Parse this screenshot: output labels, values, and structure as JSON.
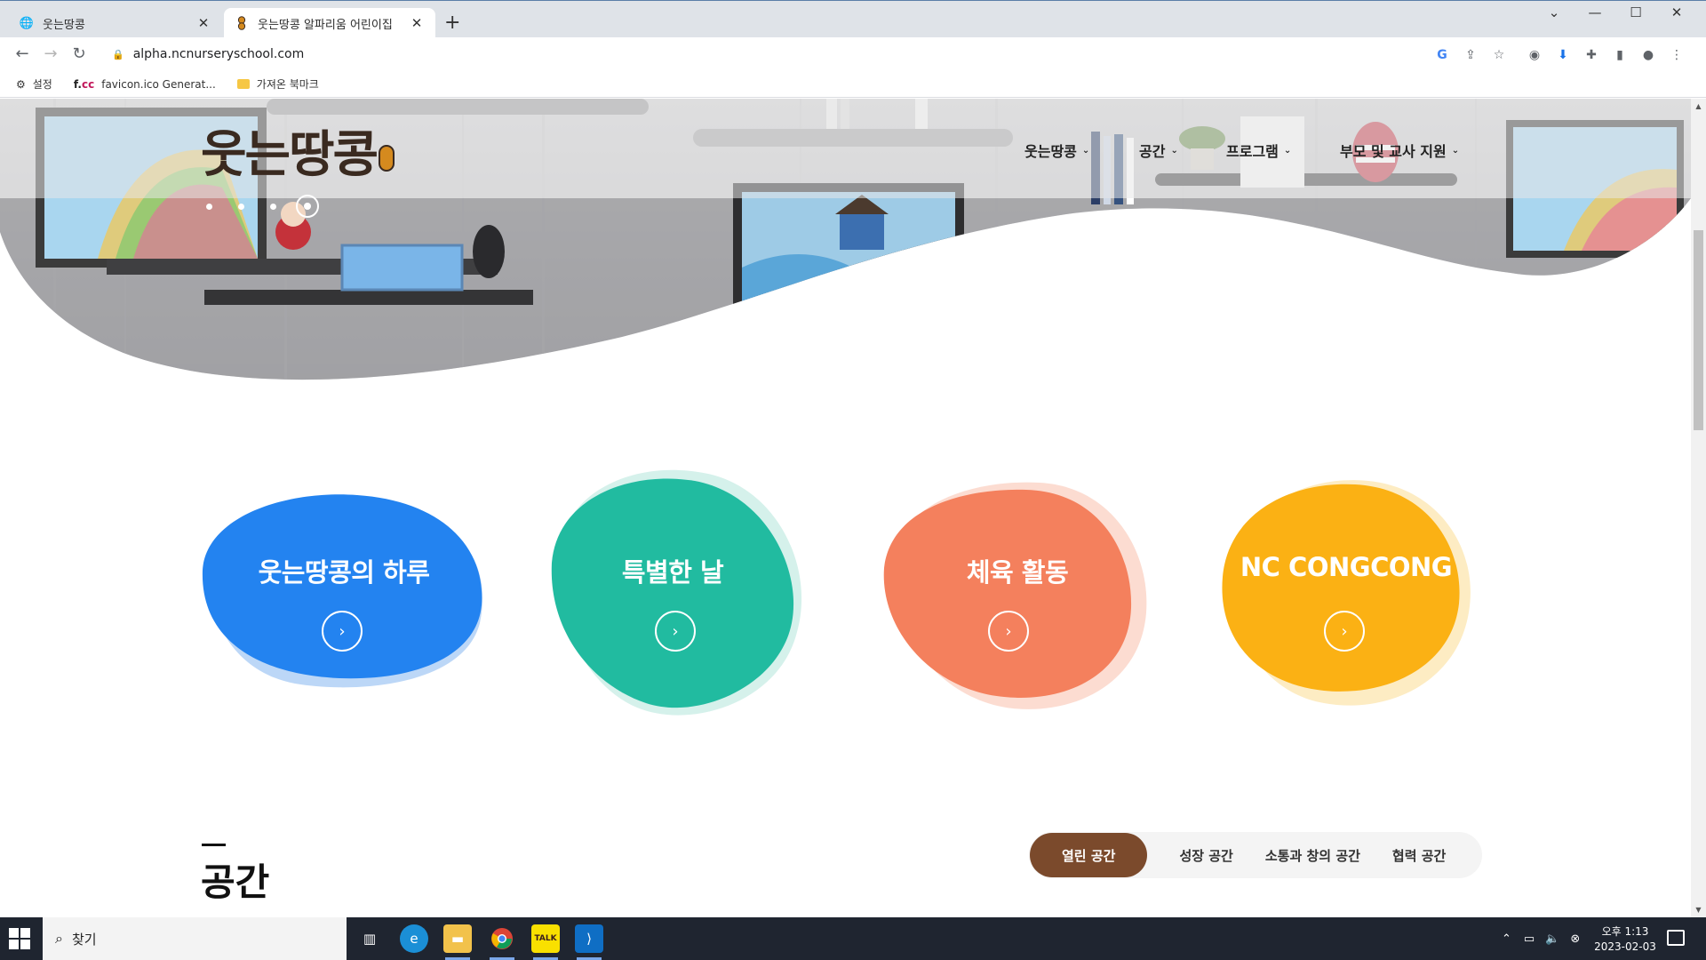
{
  "browser": {
    "tabs": [
      {
        "title": "웃는땅콩",
        "icon": "globe-icon",
        "active": false
      },
      {
        "title": "웃는땅콩 알파리움 어린이집",
        "icon": "peanut-favicon-icon",
        "active": true
      }
    ],
    "new_tab": "+",
    "url": "alpha.ncnurseryschool.com",
    "bookmarks": [
      {
        "label": "설정",
        "icon": "gear-icon"
      },
      {
        "label": "favicon.ico Generat...",
        "icon": "favicon-generator-icon",
        "icon_text": "f.cc"
      },
      {
        "label": "가져온 북마크",
        "icon": "folder-icon"
      }
    ]
  },
  "site": {
    "logo_text": "웃는땅콩",
    "nav": [
      {
        "label": "웃는땅콩"
      },
      {
        "label": "공간"
      },
      {
        "label": "프로그램"
      },
      {
        "label": "부모 및 교사 지원"
      }
    ],
    "slider": {
      "count": 4,
      "active_index": 4
    },
    "cards": [
      {
        "label": "웃는땅콩의 하루",
        "color": "#2383f0",
        "shadow": "#bcd7f7"
      },
      {
        "label": "특별한 날",
        "color": "#21bba0",
        "shadow": "#d5f1eb"
      },
      {
        "label": "체육 활동",
        "color": "#f4805d",
        "shadow": "#fcdcd1"
      },
      {
        "label": "NC CONGCONG",
        "color": "#fbb114",
        "shadow": "#fdecc3"
      }
    ],
    "space_section": {
      "title": "공간",
      "tabs": [
        "열린 공간",
        "성장 공간",
        "소통과 창의 공간",
        "협력 공간"
      ],
      "active_tab": 0,
      "accent": "#7b4a2c"
    }
  },
  "taskbar": {
    "search_placeholder": "찾기",
    "apps": [
      "task-view-icon",
      "edge-icon",
      "file-explorer-icon",
      "chrome-icon",
      "kakaotalk-icon",
      "vscode-icon"
    ],
    "clock_time": "오후 1:13",
    "clock_date": "2023-02-03"
  }
}
